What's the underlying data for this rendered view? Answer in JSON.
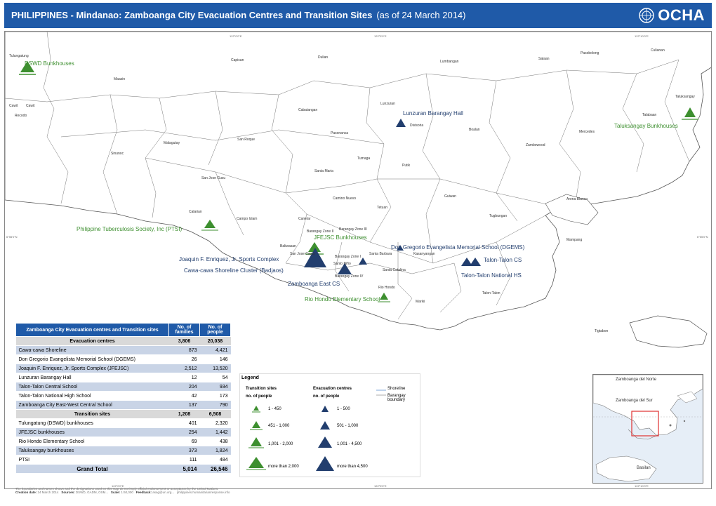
{
  "header": {
    "title": "PHILIPPINES - Mindanao:  Zamboanga City Evacuation Centres and Transition Sites",
    "subtitle": "(as of 24 March 2014)",
    "logo_text": "OCHA"
  },
  "map": {
    "place_labels": [
      {
        "text": "Tulungatung"
      },
      {
        "text": "Capisan"
      },
      {
        "text": "Dulian"
      },
      {
        "text": "Lumbangan"
      },
      {
        "text": "Salaan"
      },
      {
        "text": "Pasobolong"
      },
      {
        "text": "Culianan"
      },
      {
        "text": "Maasin"
      },
      {
        "text": "Taluksangay"
      },
      {
        "text": "Cawit"
      },
      {
        "text": "Cawit"
      },
      {
        "text": "Lunzuran"
      },
      {
        "text": "Cabatangan"
      },
      {
        "text": "Recodo"
      },
      {
        "text": "Divisoria"
      },
      {
        "text": "Talabaan"
      },
      {
        "text": "Pasonanca"
      },
      {
        "text": "Boalan"
      },
      {
        "text": "Mercedes"
      },
      {
        "text": "Malagutay"
      },
      {
        "text": "San Roque"
      },
      {
        "text": "Zambowood"
      },
      {
        "text": "Sinunoc"
      },
      {
        "text": "Tumaga"
      },
      {
        "text": "Putik"
      },
      {
        "text": "Santa Maria"
      },
      {
        "text": "San Jose Gusu"
      },
      {
        "text": "Camino Nuevo"
      },
      {
        "text": "Guiwan"
      },
      {
        "text": "Arena Blanco"
      },
      {
        "text": "Tetuan"
      },
      {
        "text": "Calarian"
      },
      {
        "text": "Campo Islam"
      },
      {
        "text": "Canelar"
      },
      {
        "text": "Tugbungan"
      },
      {
        "text": "Barangay Zone III"
      },
      {
        "text": "Barangay Zone II"
      },
      {
        "text": "Mampang"
      },
      {
        "text": "Baliwasan"
      },
      {
        "text": "San Jose Cawa"
      },
      {
        "text": "Santa Barbara"
      },
      {
        "text": "Kasanyangan"
      },
      {
        "text": "Barangay Zone I"
      },
      {
        "text": "Santo Niño"
      },
      {
        "text": "Santa Catalina"
      },
      {
        "text": "Barangay Zone IV"
      },
      {
        "text": "Rio Hondo"
      },
      {
        "text": "Talon-Talon"
      },
      {
        "text": "Mariki"
      },
      {
        "text": "Tigtabon"
      }
    ],
    "site_labels": [
      {
        "text": "DSWD Bunkhouses",
        "color": "green"
      },
      {
        "text": "Lunzuran Barangay Hall",
        "color": "blue"
      },
      {
        "text": "Taluksangay Bunkhouses",
        "color": "green"
      },
      {
        "text": "Philippine Tuberculosis Society, Inc (PTSI)",
        "color": "green"
      },
      {
        "text": "JFEJSC Bunkhouses",
        "color": "green"
      },
      {
        "text": "Don Gregorio Evangelista Memorial School (DGEMS)",
        "color": "blue"
      },
      {
        "text": "Joaquin F. Enriquez, Jr. Sports Complex",
        "color": "blue"
      },
      {
        "text": "Talon-Talon CS",
        "color": "blue"
      },
      {
        "text": "Cawa-cawa Shoreline Cluster (Badjaos)",
        "color": "blue"
      },
      {
        "text": "Talon-Talon National HS",
        "color": "blue"
      },
      {
        "text": "Zamboanga East CS",
        "color": "blue"
      },
      {
        "text": "Rio Hondo Elementary School",
        "color": "green"
      }
    ],
    "ticks": [
      "122°0'0\"E",
      "122°5'0\"E",
      "122°10'0\"E",
      "122°0'0\"E",
      "122°5'0\"E",
      "122°10'0\"E",
      "6°55'0\"N",
      "6°55'0\"N"
    ]
  },
  "table": {
    "headers": [
      "Zamboanga City Evacuation centres and Transition sites",
      "No. of families",
      "No. of people"
    ],
    "rows": [
      {
        "type": "section",
        "name": "Evacuation centres",
        "families": "3,806",
        "people": "20,038"
      },
      {
        "type": "alt",
        "name": "Cawa-cawa Shoreline",
        "families": "873",
        "people": "4,421"
      },
      {
        "type": "plain",
        "name": "Don Gregorio Evangelista Memorial School (DGEMS)",
        "families": "26",
        "people": "146"
      },
      {
        "type": "alt",
        "name": "Joaquin F. Enriquez, Jr. Sports Complex (JFEJSC)",
        "families": "2,512",
        "people": "13,520"
      },
      {
        "type": "plain",
        "name": "Lunzuran Barangay Hall",
        "families": "12",
        "people": "54"
      },
      {
        "type": "alt",
        "name": "Talon-Talon Central School",
        "families": "204",
        "people": "934"
      },
      {
        "type": "plain",
        "name": "Talon-Talon National High School",
        "families": "42",
        "people": "173"
      },
      {
        "type": "alt",
        "name": "Zamboanga City East-West Central School",
        "families": "137",
        "people": "790"
      },
      {
        "type": "section",
        "name": "Transition sites",
        "families": "1,208",
        "people": "6,508"
      },
      {
        "type": "plain",
        "name": "Tulungatung (DSWD) bunkhouses",
        "families": "401",
        "people": "2,320"
      },
      {
        "type": "alt",
        "name": "JFEJSC bunkhouses",
        "families": "254",
        "people": "1,442"
      },
      {
        "type": "plain",
        "name": "Rio Hondo Elementary School",
        "families": "69",
        "people": "438"
      },
      {
        "type": "alt",
        "name": "Taluksangay bunkhouses",
        "families": "373",
        "people": "1,824"
      },
      {
        "type": "plain",
        "name": "PTSI",
        "families": "111",
        "people": "484"
      },
      {
        "type": "total",
        "name": "Grand Total",
        "families": "5,014",
        "people": "26,546"
      }
    ]
  },
  "legend": {
    "title": "Legend",
    "transition_head": "Transition sites",
    "transition_sub": "no. of people",
    "evac_head": "Evacuation centres",
    "evac_sub": "no. of people",
    "shoreline": "Shoreline",
    "boundary": "Barangay boundary",
    "transition_classes": [
      "1 - 450",
      "451 - 1,000",
      "1,001 - 2,000",
      "more than 2,000"
    ],
    "evac_classes": [
      "1 - 500",
      "501 - 1,000",
      "1,001 - 4,500",
      "more than 4,500"
    ],
    "green": "#3d8f2f",
    "blue": "#223e6e"
  },
  "inset": {
    "labels": [
      "Zamboanga del Norte",
      "Zamboanga del Sur",
      "Basilan"
    ]
  },
  "footer": {
    "disclaimer": "The boundaries and names shown and the designations used on this map do not imply official endorsement or acceptance by the United Nations.",
    "created_label": "Creation date:",
    "created_value": "24 March 2014",
    "sources_label": "Sources:",
    "sources_value": "DSWD, GADM, OSM...",
    "scale_label": "Scale:",
    "scale_value": "1:60,000",
    "feedback_label": "Feedback:",
    "feedback_value": "asag@un.org...",
    "website": "philippines.humanitarianresponse.info"
  }
}
